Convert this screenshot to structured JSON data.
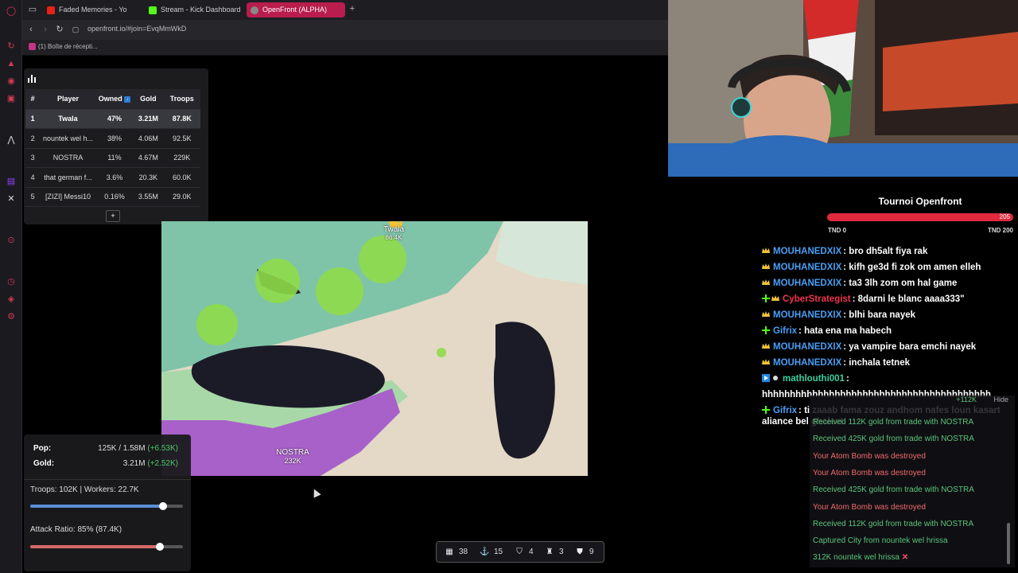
{
  "browser": {
    "tabs": [
      {
        "label": "Faded Memories - Yo",
        "color": "#e62117"
      },
      {
        "label": "Stream - Kick Dashboard",
        "color": "#53fc18"
      },
      {
        "label": "OpenFront (ALPHA)",
        "color": "#888888"
      }
    ],
    "add_tab": "+",
    "url": "openfront.io/#join=EvqMmWkD",
    "bookmark": "(1) Boîte de récepti..."
  },
  "leaderboard": {
    "headers": {
      "rank": "#",
      "player": "Player",
      "owned": "Owned",
      "gold": "Gold",
      "troops": "Troops"
    },
    "rows": [
      {
        "rank": "1",
        "player": "Twala",
        "owned": "47%",
        "gold": "3.21M",
        "troops": "87.8K"
      },
      {
        "rank": "2",
        "player": "nountek wel h...",
        "owned": "38%",
        "gold": "4.06M",
        "troops": "92.5K"
      },
      {
        "rank": "3",
        "player": "NOSTRA",
        "owned": "11%",
        "gold": "4.67M",
        "troops": "229K"
      },
      {
        "rank": "4",
        "player": "that german f...",
        "owned": "3.6%",
        "gold": "20.3K",
        "troops": "60.0K"
      },
      {
        "rank": "5",
        "player": "[ZIZI] Messi10",
        "owned": "0.16%",
        "gold": "3.55M",
        "troops": "29.0K"
      }
    ],
    "expand": "+"
  },
  "map": {
    "labels": [
      {
        "name": "Twala",
        "troops": "86.4K"
      },
      {
        "name": "NOSTRA",
        "troops": "232K"
      }
    ]
  },
  "stats": {
    "pop_label": "Pop:",
    "pop_value": "125K / 1.58M",
    "pop_delta": "(+6.53K)",
    "gold_label": "Gold:",
    "gold_value": "3.21M",
    "gold_delta": "(+2.52K)",
    "troops_text": "Troops: 102K | Workers: 22.7K",
    "troops_ratio": 0.87,
    "attack_text": "Attack Ratio: 85% (87.4K)",
    "attack_ratio": 0.85,
    "troops_color": "#5b8fd6",
    "attack_color": "#d66a6a"
  },
  "bottombar": {
    "items": [
      {
        "icon": "city-icon",
        "value": "38"
      },
      {
        "icon": "port-icon",
        "value": "15"
      },
      {
        "icon": "defense-icon",
        "value": "4"
      },
      {
        "icon": "missile-icon",
        "value": "3"
      },
      {
        "icon": "shield-icon",
        "value": "9"
      }
    ]
  },
  "tournament": {
    "title": "Tournoi Openfront",
    "progress_value": "205",
    "min_label": "TND 0",
    "max_label": "TND 200",
    "progress_color": "#e0293d"
  },
  "chat": [
    {
      "badge": "crown",
      "user": "MOUHANEDXIX",
      "user_color": "#4a9ff5",
      "text": ": bro dh5alt fiya rak"
    },
    {
      "badge": "crown",
      "user": "MOUHANEDXIX",
      "user_color": "#4a9ff5",
      "text": ": kifh ge3d fi zok om amen elleh"
    },
    {
      "badge": "crown",
      "user": "MOUHANEDXIX",
      "user_color": "#4a9ff5",
      "text": ": ta3 3lh zom om hal game"
    },
    {
      "badge": "plus-crown",
      "user": "CyberStrategist",
      "user_color": "#f0364f",
      "text": ": 8darni le blanc aaaa333\""
    },
    {
      "badge": "crown",
      "user": "MOUHANEDXIX",
      "user_color": "#4a9ff5",
      "text": ": blhi bara nayek"
    },
    {
      "badge": "plus",
      "user": "Gifrix",
      "user_color": "#4a9ff5",
      "text": ": hata ena ma habech"
    },
    {
      "badge": "crown",
      "user": "MOUHANEDXIX",
      "user_color": "#4a9ff5",
      "text": ": ya vampire bara emchi nayek"
    },
    {
      "badge": "crown",
      "user": "MOUHANEDXIX",
      "user_color": "#4a9ff5",
      "text": ": inchala tetnek"
    },
    {
      "badge": "play",
      "user": "mathlouthi001",
      "user_color": "#3ad0a0",
      "text": ":"
    },
    {
      "badge": "",
      "user": "",
      "user_color": "#ffffff",
      "text": "hhhhhhhhhhhhhhhhhhhhhhhhhhhhhhhhhhhhhhhhh"
    },
    {
      "badge": "plus",
      "user": "Gifrix",
      "user_color": "#4a9ff5",
      "text": ": ti zaaab fama zouz andhom nafes loun kasart aliance bel ghaleet"
    }
  ],
  "eventlog": {
    "header_amount": "+112K",
    "hide_label": "Hide",
    "events": [
      {
        "text": "Received 112K gold from trade with NOSTRA",
        "kind": "green"
      },
      {
        "text": "Received 425K gold from trade with NOSTRA",
        "kind": "green"
      },
      {
        "text": "Your Atom Bomb was destroyed",
        "kind": "red"
      },
      {
        "text": "Your Atom Bomb was destroyed",
        "kind": "red"
      },
      {
        "text": "Received 425K gold from trade with NOSTRA",
        "kind": "green"
      },
      {
        "text": "Your Atom Bomb was destroyed",
        "kind": "red"
      },
      {
        "text": "Received 112K gold from trade with NOSTRA",
        "kind": "green"
      },
      {
        "text": "Captured City from nountek wel hrissa",
        "kind": "green"
      },
      {
        "text": "312K nountek wel hrissa",
        "kind": "green"
      }
    ]
  }
}
